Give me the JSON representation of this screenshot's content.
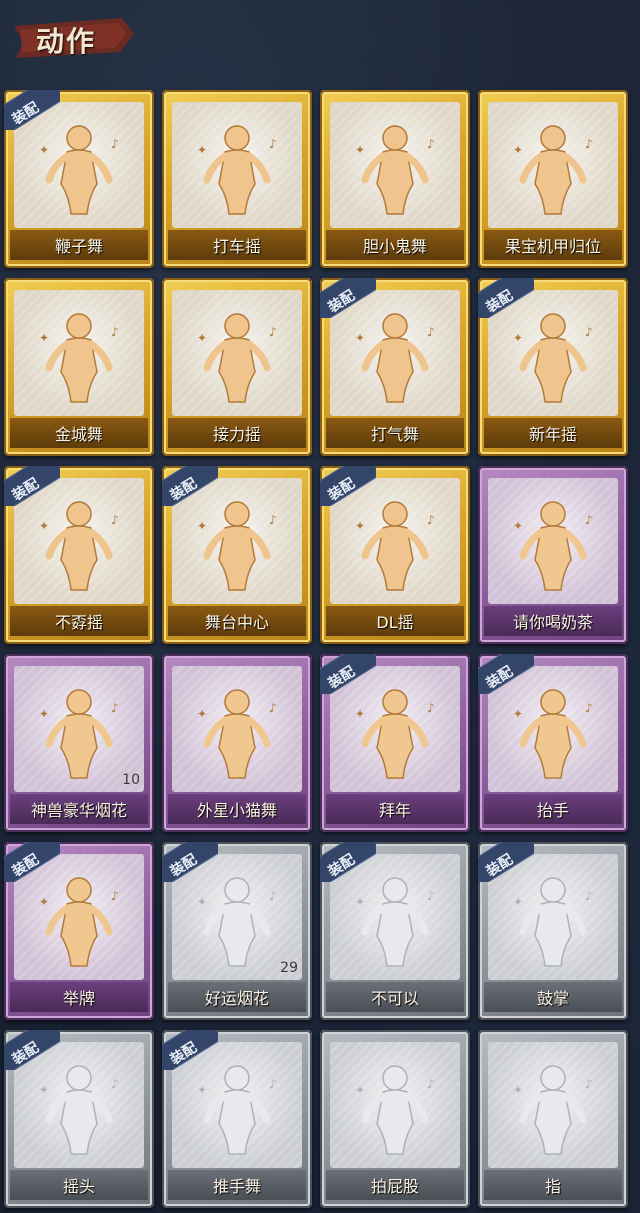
{
  "header": {
    "title": "动作"
  },
  "badge_text": "装配",
  "cards": [
    {
      "label": "鞭子舞",
      "tier": "gold",
      "equipped": true,
      "icon": "whip-dance-figure-icon"
    },
    {
      "label": "打车摇",
      "tier": "gold",
      "equipped": false,
      "icon": "taxi-shake-figure-icon"
    },
    {
      "label": "胆小鬼舞",
      "tier": "gold",
      "equipped": false,
      "icon": "coward-dance-figure-icon"
    },
    {
      "label": "果宝机甲归位",
      "tier": "gold",
      "equipped": false,
      "icon": "mecha-pose-figure-icon"
    },
    {
      "label": "金城舞",
      "tier": "gold",
      "equipped": false,
      "icon": "jincheng-dance-figure-icon"
    },
    {
      "label": "接力摇",
      "tier": "gold",
      "equipped": false,
      "icon": "relay-shake-figure-icon"
    },
    {
      "label": "打气舞",
      "tier": "gold",
      "equipped": true,
      "icon": "cheer-dance-figure-icon"
    },
    {
      "label": "新年摇",
      "tier": "gold",
      "equipped": true,
      "icon": "new-year-shake-figure-icon"
    },
    {
      "label": "不孬摇",
      "tier": "gold",
      "equipped": true,
      "icon": "point-up-figure-icon"
    },
    {
      "label": "舞台中心",
      "tier": "gold",
      "equipped": true,
      "icon": "center-stage-figure-icon"
    },
    {
      "label": "DL摇",
      "tier": "gold",
      "equipped": true,
      "icon": "dl-shake-figure-icon"
    },
    {
      "label": "请你喝奶茶",
      "tier": "purple",
      "equipped": false,
      "icon": "milk-tea-sign-figure-icon"
    },
    {
      "label": "神兽豪华烟花",
      "tier": "purple",
      "equipped": false,
      "icon": "luxury-fireworks-icon",
      "count": "10"
    },
    {
      "label": "外星小猫舞",
      "tier": "purple",
      "equipped": false,
      "icon": "alien-cat-dance-figure-icon"
    },
    {
      "label": "拜年",
      "tier": "purple",
      "equipped": true,
      "icon": "new-year-greeting-figure-icon"
    },
    {
      "label": "抬手",
      "tier": "purple",
      "equipped": true,
      "icon": "raise-hand-figure-icon"
    },
    {
      "label": "举牌",
      "tier": "purple",
      "equipped": true,
      "icon": "hold-sign-figure-icon"
    },
    {
      "label": "好运烟花",
      "tier": "silver",
      "equipped": true,
      "icon": "lucky-firework-icon",
      "count": "29"
    },
    {
      "label": "不可以",
      "tier": "silver",
      "equipped": true,
      "icon": "finger-wag-icon"
    },
    {
      "label": "鼓掌",
      "tier": "silver",
      "equipped": true,
      "icon": "clapping-hands-icon"
    },
    {
      "label": "摇头",
      "tier": "silver",
      "equipped": true,
      "icon": "head-shake-figure-icon"
    },
    {
      "label": "推手舞",
      "tier": "silver",
      "equipped": true,
      "icon": "push-hand-dance-figure-icon"
    },
    {
      "label": "拍屁股",
      "tier": "silver",
      "equipped": false,
      "icon": "butt-slap-figure-icon"
    },
    {
      "label": "指",
      "tier": "silver",
      "equipped": false,
      "icon": "pointing-hand-icon"
    }
  ]
}
